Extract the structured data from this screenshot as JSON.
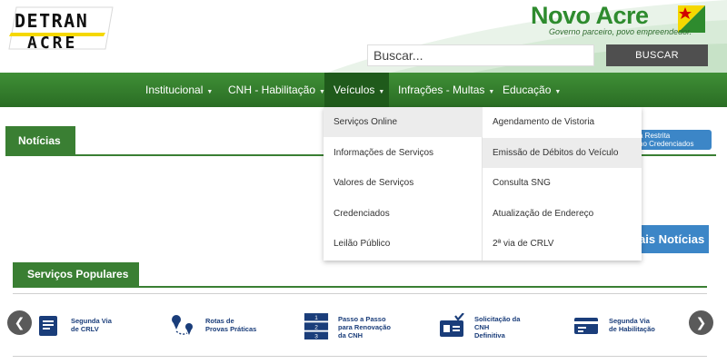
{
  "header": {
    "detran_logo_text": [
      "DETRAN",
      "ACRE"
    ],
    "novo_acre_brand": "Novo Acre",
    "novo_acre_tagline": "Governo parceiro, povo empreendedor.",
    "search_placeholder": "Buscar...",
    "search_button": "BUSCAR"
  },
  "nav": {
    "items": [
      {
        "label": "Institucional"
      },
      {
        "label": "CNH - Habilitação"
      },
      {
        "label": "Veículos",
        "active": true
      },
      {
        "label": "Infrações - Multas"
      },
      {
        "label": "Educação"
      }
    ]
  },
  "dropdown": {
    "left": [
      {
        "label": "Serviços Online",
        "highlight": true
      },
      {
        "label": "Informações de Serviços"
      },
      {
        "label": "Valores de Serviços"
      },
      {
        "label": "Credenciados"
      },
      {
        "label": "Leilão Público"
      }
    ],
    "right": [
      {
        "label": "Agendamento de Vistoria"
      },
      {
        "label": "Emissão de Débitos do Veículo",
        "highlight": true
      },
      {
        "label": "Consulta SNG"
      },
      {
        "label": "Atualização de Endereço"
      },
      {
        "label": "2ª via de CRLV"
      }
    ]
  },
  "content": {
    "noticias_title": "Notícias",
    "restrita_line1": "a Restrita",
    "restrita_line2": "ho Credenciados",
    "mais_noticias": "ais Notícias",
    "servicos_title": "Serviços Populares"
  },
  "services": [
    {
      "label1": "Segunda Via",
      "label2": "de CRLV",
      "label3": "",
      "label4": "",
      "icon": "document-icon"
    },
    {
      "label1": "Rotas de",
      "label2": "Provas Práticas",
      "label3": "",
      "label4": "",
      "icon": "route-pin-icon"
    },
    {
      "label1": "Passo a Passo",
      "label2": "para Renovação",
      "label3": "da CNH",
      "label4": "",
      "icon": "steps-icon",
      "steps": [
        "1",
        "2",
        "3"
      ]
    },
    {
      "label1": "Solicitação da",
      "label2": "CNH",
      "label3": "Definitiva",
      "label4": "",
      "icon": "id-card-check-icon"
    },
    {
      "label1": "Segunda Via",
      "label2": "de Habilitação",
      "label3": "",
      "label4": "",
      "icon": "license-card-icon"
    }
  ],
  "colors": {
    "green": "#3a7f33",
    "blue": "#3c86c7",
    "navy": "#1a3d7a"
  }
}
